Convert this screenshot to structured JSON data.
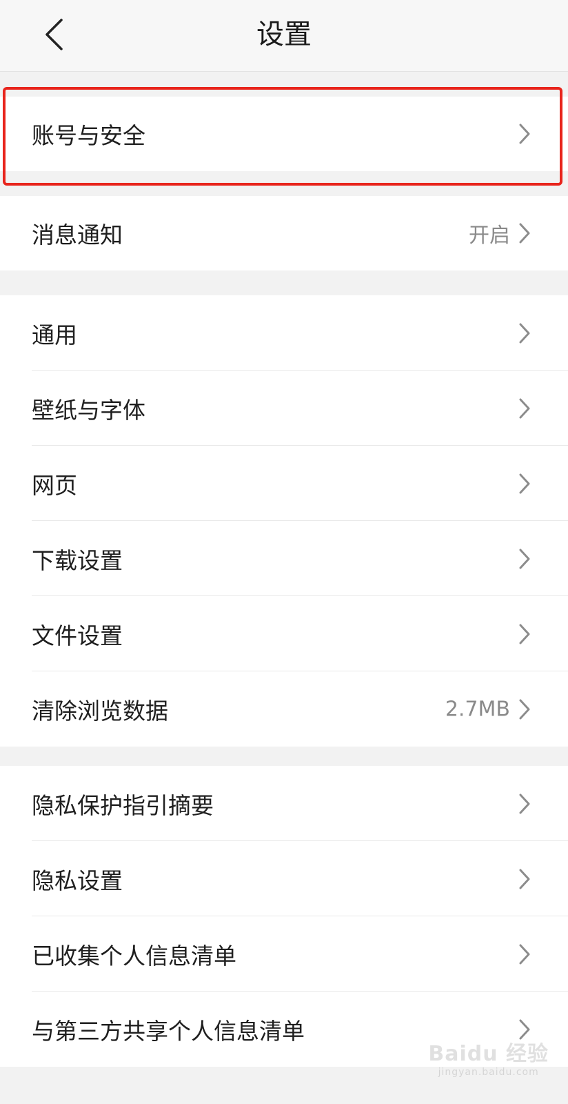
{
  "header": {
    "title": "设置",
    "back_icon": "back-arrow-icon"
  },
  "sections": [
    {
      "items": [
        {
          "label": "账号与安全",
          "value": "",
          "icon": "chevron-right-icon"
        }
      ]
    },
    {
      "items": [
        {
          "label": "消息通知",
          "value": "开启",
          "icon": "chevron-right-icon"
        }
      ]
    },
    {
      "items": [
        {
          "label": "通用",
          "value": "",
          "icon": "chevron-right-icon"
        },
        {
          "label": "壁纸与字体",
          "value": "",
          "icon": "chevron-right-icon"
        },
        {
          "label": "网页",
          "value": "",
          "icon": "chevron-right-icon"
        },
        {
          "label": "下载设置",
          "value": "",
          "icon": "chevron-right-icon"
        },
        {
          "label": "文件设置",
          "value": "",
          "icon": "chevron-right-icon"
        },
        {
          "label": "清除浏览数据",
          "value": "2.7MB",
          "icon": "chevron-right-icon"
        }
      ]
    },
    {
      "items": [
        {
          "label": "隐私保护指引摘要",
          "value": "",
          "icon": "chevron-right-icon"
        },
        {
          "label": "隐私设置",
          "value": "",
          "icon": "chevron-right-icon"
        },
        {
          "label": "已收集个人信息清单",
          "value": "",
          "icon": "chevron-right-icon"
        },
        {
          "label": "与第三方共享个人信息清单",
          "value": "",
          "icon": "chevron-right-icon"
        }
      ]
    }
  ],
  "watermark": {
    "main": "Baidu 经验",
    "sub": "jingyan.baidu.com"
  },
  "colors": {
    "highlight": "#e8241c",
    "background": "#f2f2f2",
    "row": "#ffffff",
    "value_text": "#8a8a8a"
  }
}
